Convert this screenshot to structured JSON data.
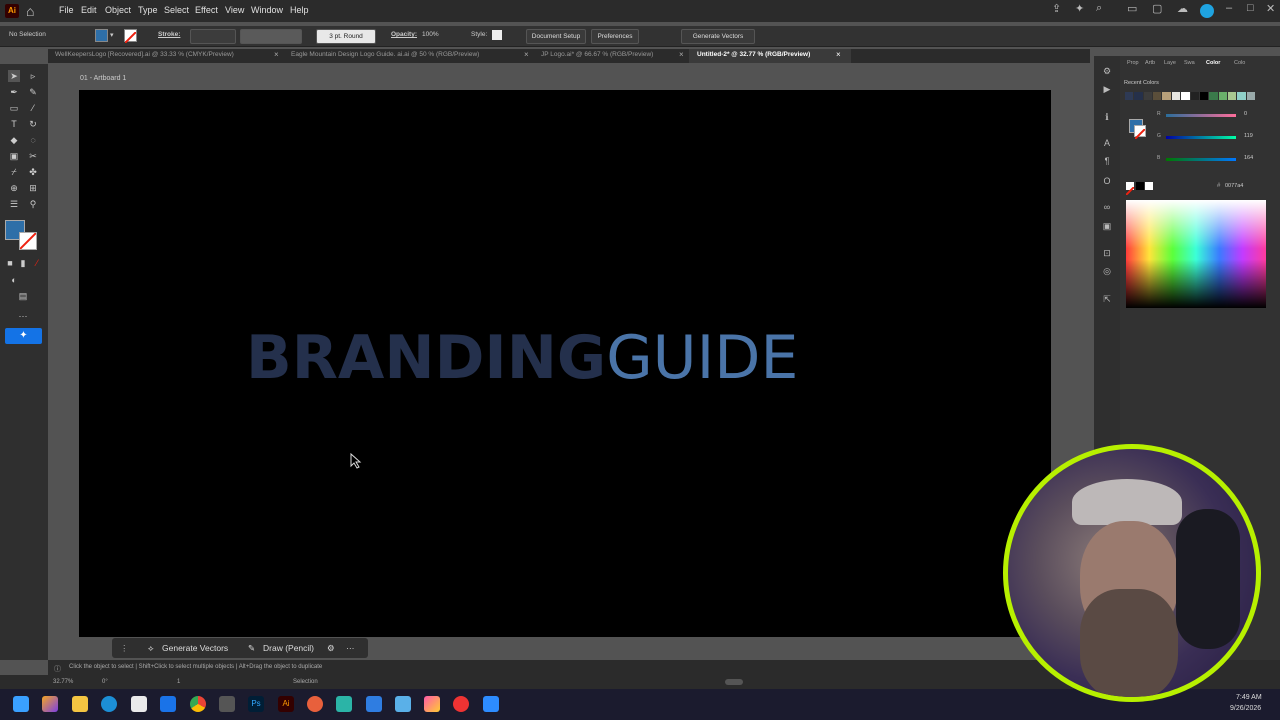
{
  "menubar": {
    "logo": "Ai",
    "items": [
      "File",
      "Edit",
      "Object",
      "Type",
      "Select",
      "Effect",
      "View",
      "Window",
      "Help"
    ]
  },
  "controlbar": {
    "selection": "No Selection",
    "stroke_label": "Stroke:",
    "brush": "3 pt. Round",
    "opacity_label": "Opacity:",
    "opacity_value": "100%",
    "style_label": "Style:",
    "document_setup": "Document Setup",
    "preferences": "Preferences",
    "generate_vectors": "Generate Vectors"
  },
  "tabs": [
    {
      "label": "WellKeepersLogo [Recovered].ai @ 33.33 % (CMYK/Preview)"
    },
    {
      "label": "Eagle Mountain Design Logo Guide. ai.ai @ 50 % (RGB/Preview)"
    },
    {
      "label": "JP Logo.ai* @ 66.67 % (RGB/Preview)"
    },
    {
      "label": "Untitled-2* @ 32.77 % (RGB/Preview)"
    }
  ],
  "artboard": {
    "label": "01 - Artboard 1",
    "headline_bold": "BRANDING",
    "headline_light": "GUIDE"
  },
  "contextbar": {
    "generate_vectors": "Generate Vectors",
    "draw": "Draw (Pencil)"
  },
  "panel": {
    "tabs": [
      "Prop",
      "Artb",
      "Laye",
      "Swa",
      "Color",
      "Colo"
    ],
    "recent_colors": "Recent Colors",
    "r_value": "0",
    "g_value": "119",
    "b_value": "164",
    "r_label": "R",
    "g_label": "G",
    "b_label": "B",
    "hex": "0077a4",
    "hex_symbol": "#"
  },
  "statusbar": {
    "hint": "Click the object to select  |  Shift+Click to select multiple objects  |  Alt+Drag the object to duplicate",
    "zoom": "32.77%",
    "rotation": "0°",
    "artboard_num": "1",
    "tool": "Selection"
  },
  "taskbar": {
    "time": "7:49 AM",
    "date": "9/26/2026"
  },
  "colors": {
    "accent_fill": "#2e6fa8",
    "headline_bold": "#24304c",
    "headline_light": "#4a74a8",
    "webcam_ring": "#b7f000"
  }
}
